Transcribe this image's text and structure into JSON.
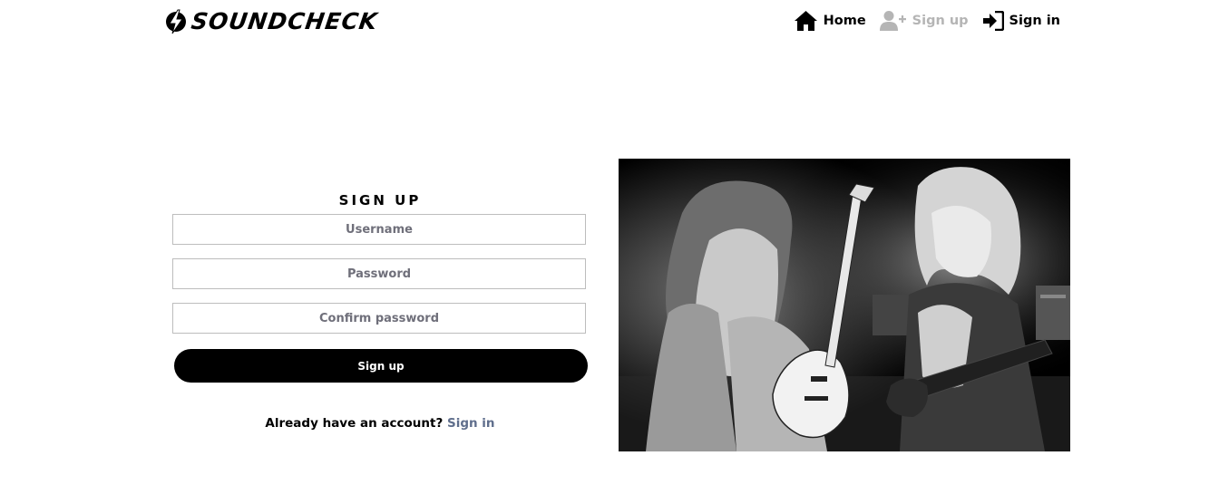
{
  "header": {
    "brand": "SOUNDCHECK",
    "nav": [
      {
        "label": "Home",
        "icon": "home-icon",
        "state": "active"
      },
      {
        "label": "Sign up",
        "icon": "user-plus-icon",
        "state": "disabled"
      },
      {
        "label": "Sign in",
        "icon": "sign-in-icon",
        "state": "active"
      }
    ]
  },
  "form": {
    "title": "SIGN UP",
    "username_placeholder": "Username",
    "password_placeholder": "Password",
    "confirm_placeholder": "Confirm password",
    "submit_label": "Sign up",
    "already_text": "Already have an account?",
    "signin_link": "Sign in"
  },
  "colors": {
    "text": "#000000",
    "disabled_nav": "#b5b5b5",
    "link": "#5f6e8c",
    "button_bg": "#000000",
    "input_border": "#bdbdbd"
  },
  "image": {
    "icon": "concert-photo"
  }
}
